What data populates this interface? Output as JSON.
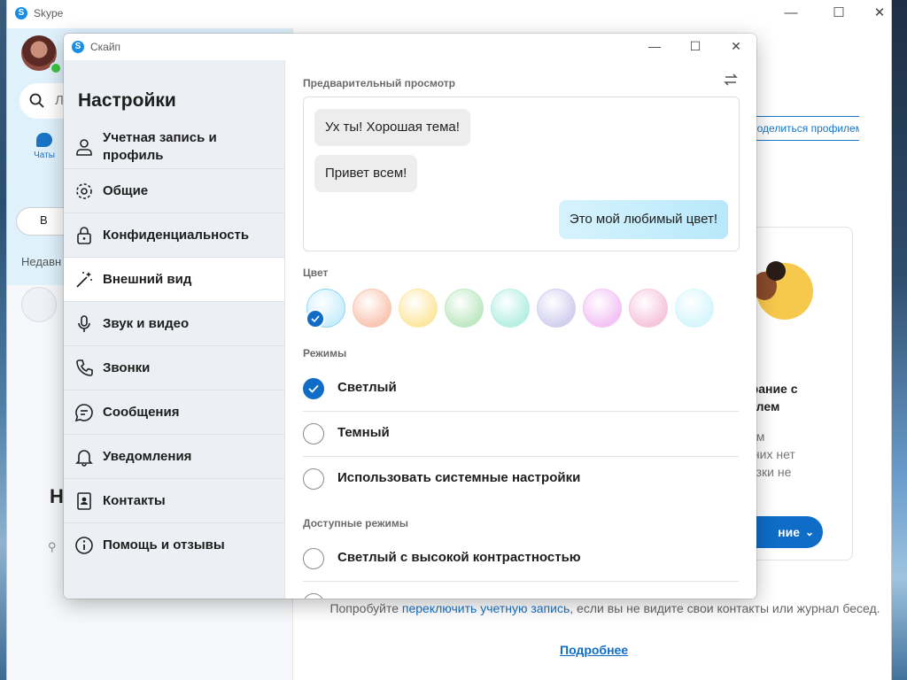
{
  "main_window": {
    "title": "Skype",
    "controls": [
      "—",
      "☐",
      "✕"
    ],
    "sidebar": {
      "search_placeholder_partial": "Л",
      "chats_tab": "Чаты",
      "meet_button_partial": "В",
      "recent_label_partial": "Недавн",
      "big_heading_partial": "Н"
    },
    "share_profile_partial": "Поделиться профилем",
    "card": {
      "title_partial_line1": "брание с",
      "title_partial_line2": "телем",
      "text_line1": "сем",
      "text_line2": "у них нет",
      "text_line3": "рузки не",
      "button_partial": "ние"
    },
    "bottom": {
      "text_before": "Попробуйте ",
      "link": "переключить учетную запись",
      "text_after": ", если вы не видите свои контакты или журнал бесед.",
      "more_link": "Подробнее"
    }
  },
  "settings": {
    "window_title": "Скайп",
    "heading": "Настройки",
    "nav": [
      {
        "label": "Учетная запись и профиль",
        "icon": "person-icon"
      },
      {
        "label": "Общие",
        "icon": "gear-icon"
      },
      {
        "label": "Конфиденциальность",
        "icon": "lock-icon"
      },
      {
        "label": "Внешний вид",
        "icon": "magic-wand-icon"
      },
      {
        "label": "Звук и видео",
        "icon": "microphone-icon"
      },
      {
        "label": "Звонки",
        "icon": "phone-icon"
      },
      {
        "label": "Сообщения",
        "icon": "message-icon"
      },
      {
        "label": "Уведомления",
        "icon": "bell-icon"
      },
      {
        "label": "Контакты",
        "icon": "contacts-icon"
      },
      {
        "label": "Помощь и отзывы",
        "icon": "info-icon"
      }
    ],
    "active_nav": "Внешний вид",
    "preview_label": "Предварительный просмотр",
    "preview_messages": {
      "incoming1": "Ух ты! Хорошая тема!",
      "incoming2": "Привет всем!",
      "outgoing": "Это мой любимый цвет!"
    },
    "color_label": "Цвет",
    "colors": [
      "#c9eefb",
      "#f9c7b3",
      "#fde7a3",
      "#bfe9c4",
      "#b7efe3",
      "#d3d0ef",
      "#f3c3f5",
      "#f6c6dd",
      "#d6f6fb"
    ],
    "selected_color_index": 0,
    "modes_label": "Режимы",
    "modes": [
      {
        "label": "Светлый",
        "selected": true
      },
      {
        "label": "Темный",
        "selected": false
      },
      {
        "label": "Использовать системные настройки",
        "selected": false
      }
    ],
    "available_modes_label": "Доступные режимы",
    "available_modes": [
      {
        "label": "Светлый с высокой контрастностью",
        "selected": false
      }
    ],
    "accent_color": "#0f6dc8"
  }
}
